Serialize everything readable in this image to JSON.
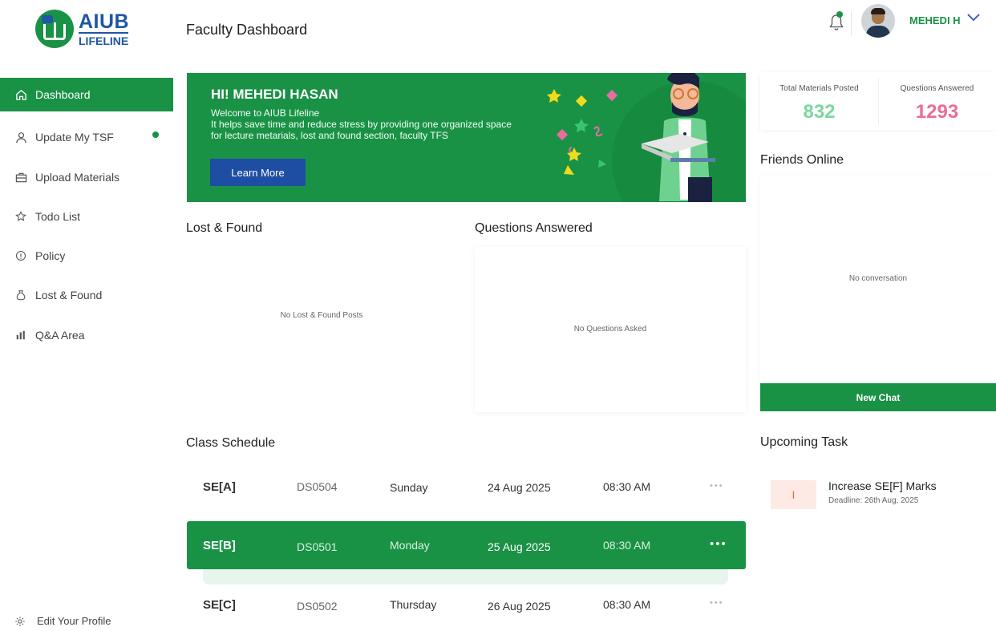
{
  "brand": {
    "name": "AIUB",
    "sub": "LIFELINE"
  },
  "header": {
    "title": "Faculty Dashboard",
    "user_name": "MEHEDI H"
  },
  "sidebar": {
    "items": [
      {
        "label": "Dashboard",
        "icon": "home-icon"
      },
      {
        "label": "Update My TSF",
        "icon": "user-icon"
      },
      {
        "label": "Upload Materials",
        "icon": "briefcase-icon"
      },
      {
        "label": "Todo List",
        "icon": "star-icon"
      },
      {
        "label": "Policy",
        "icon": "info-icon"
      },
      {
        "label": "Lost & Found",
        "icon": "money-bag-icon"
      },
      {
        "label": "Q&A Area",
        "icon": "bar-chart-icon"
      }
    ],
    "edit_profile": "Edit Your Profile"
  },
  "banner": {
    "greeting": "HI! MEHEDI HASAN",
    "line1": "Welcome to AIUB Lifeline",
    "line2": "It helps save time and reduce stress by providing one organized space",
    "line3": "for lecture metarials, lost and found section, faculty TFS",
    "button": "Learn More"
  },
  "stats": {
    "materials_label": "Total Materials Posted",
    "materials_value": "832",
    "questions_label": "Questions Answered",
    "questions_value": "1293",
    "materials_color": "#7cd89d",
    "questions_color": "#ea6c9a"
  },
  "lost_found": {
    "title": "Lost & Found",
    "empty": "No Lost & Found Posts"
  },
  "questions": {
    "title": "Questions Answered",
    "empty": "No Questions Asked"
  },
  "friends": {
    "title": "Friends Online",
    "empty": "No conversation",
    "button": "New Chat"
  },
  "schedule": {
    "title": "Class Schedule",
    "rows": [
      {
        "code": "SE[A]",
        "room": "DS0504",
        "day": "Sunday",
        "date": "24 Aug 2025",
        "time": "08:30 AM"
      },
      {
        "code": "SE[B]",
        "room": "DS0501",
        "day": "Monday",
        "date": "25 Aug 2025",
        "time": "08:30 AM"
      },
      {
        "code": "SE[C]",
        "room": "DS0502",
        "day": "Thursday",
        "date": "26 Aug 2025",
        "time": "08:30 AM"
      }
    ],
    "more": "•••"
  },
  "tasks": {
    "title": "Upcoming Task",
    "items": [
      {
        "badge": "I",
        "title": "Increase SE[F] Marks",
        "deadline": "Deadline: 26th Aug, 2025"
      }
    ]
  },
  "colors": {
    "primary": "#1a9246",
    "accent_blue": "#1e4ea3"
  }
}
